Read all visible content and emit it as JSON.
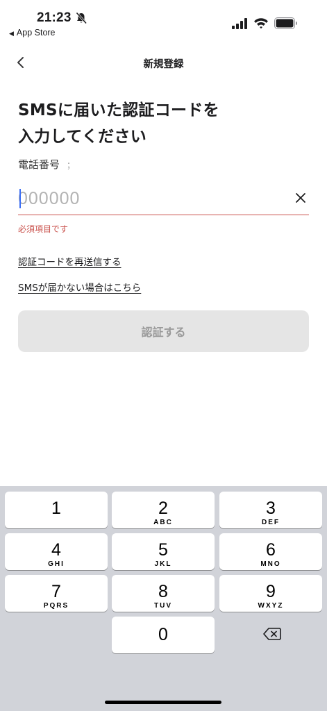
{
  "status_bar": {
    "time": "21:23",
    "back_app_label": "App Store"
  },
  "nav": {
    "title": "新規登録"
  },
  "main": {
    "heading_line1": "SMSに届いた認証コードを",
    "heading_line2": "入力してください",
    "phone_label": "電話番号",
    "phone_value": "；",
    "code_placeholder": "000000",
    "code_value": "",
    "error_text": "必須項目です",
    "resend_link": "認証コードを再送信する",
    "no_sms_link": "SMSが届かない場合はこちら",
    "verify_button": "認証する",
    "error_color": "#c9504b",
    "disabled_button_color": "#e5e5e5"
  },
  "keyboard": {
    "keys": [
      {
        "num": "1",
        "letters": ""
      },
      {
        "num": "2",
        "letters": "ABC"
      },
      {
        "num": "3",
        "letters": "DEF"
      },
      {
        "num": "4",
        "letters": "GHI"
      },
      {
        "num": "5",
        "letters": "JKL"
      },
      {
        "num": "6",
        "letters": "MNO"
      },
      {
        "num": "7",
        "letters": "PQRS"
      },
      {
        "num": "8",
        "letters": "TUV"
      },
      {
        "num": "9",
        "letters": "WXYZ"
      },
      {
        "num": "0",
        "letters": ""
      }
    ],
    "delete_icon": "delete-backspace-icon"
  }
}
